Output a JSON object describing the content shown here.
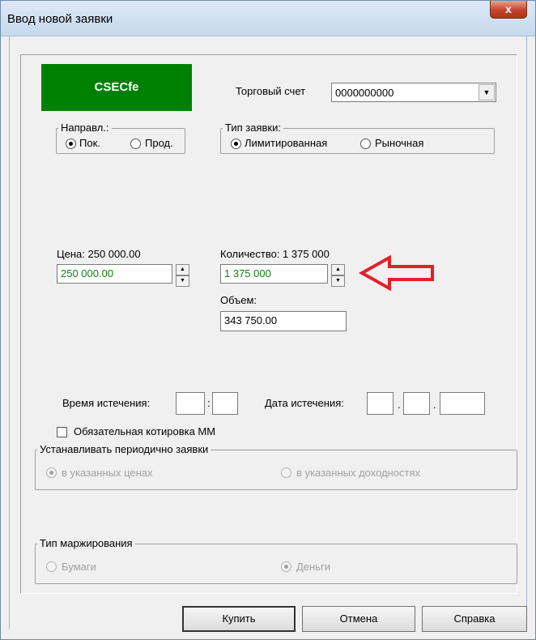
{
  "window": {
    "title": "Ввод новой заявки",
    "close_label": "x"
  },
  "header": {
    "instrument": "CSECfe",
    "account_label": "Торговый счет",
    "account_value": "0000000000"
  },
  "direction": {
    "title": "Направл.:",
    "options": [
      "Пок.",
      "Прод."
    ],
    "selected": "Пок."
  },
  "order_type": {
    "title": "Тип заявки:",
    "options": [
      "Лимитированная",
      "Рыночная"
    ],
    "selected": "Лимитированная"
  },
  "price": {
    "label": "Цена: 250 000.00",
    "value": "250 000.00"
  },
  "quantity": {
    "label": "Количество: 1 375 000",
    "value": "1 375 000"
  },
  "volume": {
    "label": "Объем:",
    "value": "343 750.00"
  },
  "expiration": {
    "time_label": "Время истечения:",
    "time_sep": ":",
    "date_label": "Дата истечения:",
    "date_sep1": ".",
    "date_sep2": "."
  },
  "mm_quote": {
    "label": "Обязательная котировка ММ",
    "checked": false
  },
  "periodic": {
    "title": "Устанавливать периодично заявки",
    "options": [
      "в указанных ценах",
      "в указанных доходностях"
    ],
    "selected": "в указанных ценах"
  },
  "margin": {
    "title": "Тип маржирования",
    "options": [
      "Бумаги",
      "Деньги"
    ],
    "selected": "Деньги"
  },
  "buttons": {
    "buy": "Купить",
    "cancel": "Отмена",
    "help": "Справка"
  },
  "colors": {
    "accent_green": "#008000",
    "value_green": "#108010",
    "annotation_red": "#e0202a"
  },
  "icons": {
    "combo": "chevron-down-icon",
    "spin_up": "triangle-up-icon",
    "spin_down": "triangle-down-icon",
    "annotation": "arrow-left-icon"
  }
}
